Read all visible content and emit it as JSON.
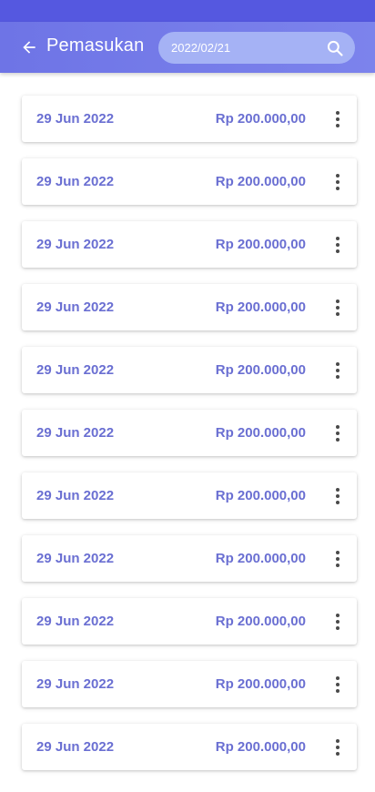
{
  "header": {
    "title": "Pemasukan",
    "back_icon": "arrow-left-icon",
    "search": {
      "value": "2022/02/21",
      "icon": "search-icon"
    },
    "colors": {
      "status_bar": "#5558e0",
      "app_bar": "#7277e8",
      "search_bg": "#a5b2f5"
    }
  },
  "accent_color": "#6a6fd2",
  "items": [
    {
      "date": "29 Jun 2022",
      "amount": "Rp 200.000,00"
    },
    {
      "date": "29 Jun 2022",
      "amount": "Rp 200.000,00"
    },
    {
      "date": "29 Jun 2022",
      "amount": "Rp 200.000,00"
    },
    {
      "date": "29 Jun 2022",
      "amount": "Rp 200.000,00"
    },
    {
      "date": "29 Jun 2022",
      "amount": "Rp 200.000,00"
    },
    {
      "date": "29 Jun 2022",
      "amount": "Rp 200.000,00"
    },
    {
      "date": "29 Jun 2022",
      "amount": "Rp 200.000,00"
    },
    {
      "date": "29 Jun 2022",
      "amount": "Rp 200.000,00"
    },
    {
      "date": "29 Jun 2022",
      "amount": "Rp 200.000,00"
    },
    {
      "date": "29 Jun 2022",
      "amount": "Rp 200.000,00"
    },
    {
      "date": "29 Jun 2022",
      "amount": "Rp 200.000,00"
    }
  ]
}
